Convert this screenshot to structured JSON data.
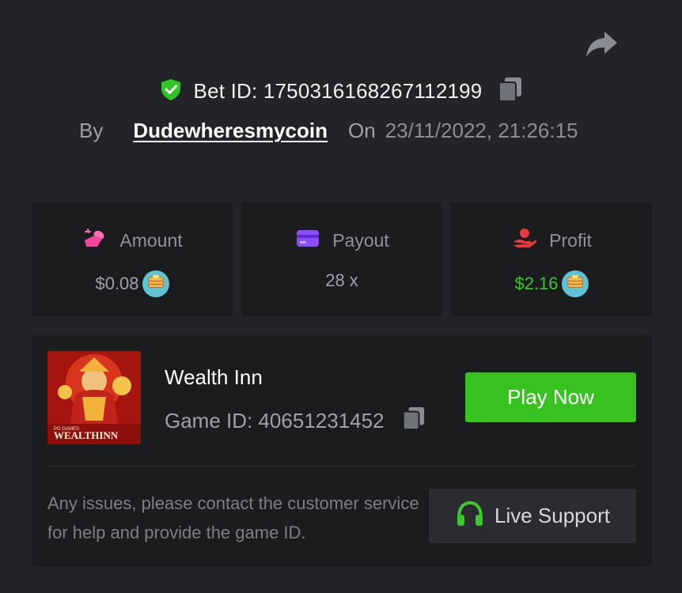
{
  "header": {
    "bet_label": "Bet ID: 1750316168267112199",
    "by_label": "By",
    "username": "Dudewheresmycoin",
    "on_label": "On",
    "datetime": "23/11/2022, 21:26:15"
  },
  "stats": {
    "amount": {
      "label": "Amount",
      "value": "$0.08",
      "icon": "money-bag-icon"
    },
    "payout": {
      "label": "Payout",
      "value": "28 x",
      "icon": "card-icon"
    },
    "profit": {
      "label": "Profit",
      "value": "$2.16",
      "icon": "hand-coin-icon"
    }
  },
  "game": {
    "name": "Wealth Inn",
    "id_label": "Game ID: 40651231452",
    "thumbnail_text": "WEALTHINN",
    "thumbnail_brand": "PG GAMES",
    "play_label": "Play Now"
  },
  "support": {
    "message": "Any issues, please contact the customer service for help and provide the game ID.",
    "button_label": "Live Support"
  },
  "colors": {
    "background": "#232427",
    "panel": "#1b1c1e",
    "accent_green": "#38c21f",
    "profit_green": "#3ec72e",
    "muted_text": "#9ea1a8"
  }
}
